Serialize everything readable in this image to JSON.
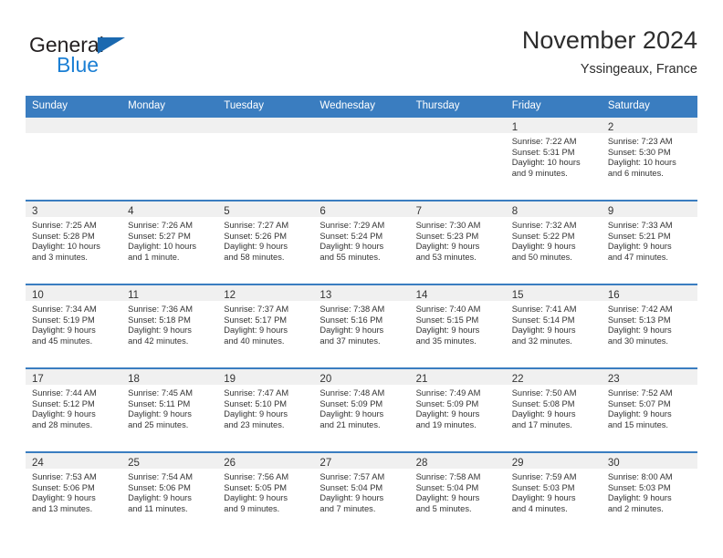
{
  "brand": {
    "name_part1": "General",
    "name_part2": "Blue",
    "triangle_color": "#1b69b0",
    "blue_color": "#1b7fd4"
  },
  "header": {
    "title": "November 2024",
    "subtitle": "Yssingeaux, France"
  },
  "theme": {
    "header_bg": "#3a7dc0",
    "daynum_bg": "#f0f0f0",
    "text": "#333333"
  },
  "weekdays": [
    "Sunday",
    "Monday",
    "Tuesday",
    "Wednesday",
    "Thursday",
    "Friday",
    "Saturday"
  ],
  "weeks": [
    [
      {
        "day": "",
        "lines": []
      },
      {
        "day": "",
        "lines": []
      },
      {
        "day": "",
        "lines": []
      },
      {
        "day": "",
        "lines": []
      },
      {
        "day": "",
        "lines": []
      },
      {
        "day": "1",
        "lines": [
          "Sunrise: 7:22 AM",
          "Sunset: 5:31 PM",
          "Daylight: 10 hours",
          "and 9 minutes."
        ]
      },
      {
        "day": "2",
        "lines": [
          "Sunrise: 7:23 AM",
          "Sunset: 5:30 PM",
          "Daylight: 10 hours",
          "and 6 minutes."
        ]
      }
    ],
    [
      {
        "day": "3",
        "lines": [
          "Sunrise: 7:25 AM",
          "Sunset: 5:28 PM",
          "Daylight: 10 hours",
          "and 3 minutes."
        ]
      },
      {
        "day": "4",
        "lines": [
          "Sunrise: 7:26 AM",
          "Sunset: 5:27 PM",
          "Daylight: 10 hours",
          "and 1 minute."
        ]
      },
      {
        "day": "5",
        "lines": [
          "Sunrise: 7:27 AM",
          "Sunset: 5:26 PM",
          "Daylight: 9 hours",
          "and 58 minutes."
        ]
      },
      {
        "day": "6",
        "lines": [
          "Sunrise: 7:29 AM",
          "Sunset: 5:24 PM",
          "Daylight: 9 hours",
          "and 55 minutes."
        ]
      },
      {
        "day": "7",
        "lines": [
          "Sunrise: 7:30 AM",
          "Sunset: 5:23 PM",
          "Daylight: 9 hours",
          "and 53 minutes."
        ]
      },
      {
        "day": "8",
        "lines": [
          "Sunrise: 7:32 AM",
          "Sunset: 5:22 PM",
          "Daylight: 9 hours",
          "and 50 minutes."
        ]
      },
      {
        "day": "9",
        "lines": [
          "Sunrise: 7:33 AM",
          "Sunset: 5:21 PM",
          "Daylight: 9 hours",
          "and 47 minutes."
        ]
      }
    ],
    [
      {
        "day": "10",
        "lines": [
          "Sunrise: 7:34 AM",
          "Sunset: 5:19 PM",
          "Daylight: 9 hours",
          "and 45 minutes."
        ]
      },
      {
        "day": "11",
        "lines": [
          "Sunrise: 7:36 AM",
          "Sunset: 5:18 PM",
          "Daylight: 9 hours",
          "and 42 minutes."
        ]
      },
      {
        "day": "12",
        "lines": [
          "Sunrise: 7:37 AM",
          "Sunset: 5:17 PM",
          "Daylight: 9 hours",
          "and 40 minutes."
        ]
      },
      {
        "day": "13",
        "lines": [
          "Sunrise: 7:38 AM",
          "Sunset: 5:16 PM",
          "Daylight: 9 hours",
          "and 37 minutes."
        ]
      },
      {
        "day": "14",
        "lines": [
          "Sunrise: 7:40 AM",
          "Sunset: 5:15 PM",
          "Daylight: 9 hours",
          "and 35 minutes."
        ]
      },
      {
        "day": "15",
        "lines": [
          "Sunrise: 7:41 AM",
          "Sunset: 5:14 PM",
          "Daylight: 9 hours",
          "and 32 minutes."
        ]
      },
      {
        "day": "16",
        "lines": [
          "Sunrise: 7:42 AM",
          "Sunset: 5:13 PM",
          "Daylight: 9 hours",
          "and 30 minutes."
        ]
      }
    ],
    [
      {
        "day": "17",
        "lines": [
          "Sunrise: 7:44 AM",
          "Sunset: 5:12 PM",
          "Daylight: 9 hours",
          "and 28 minutes."
        ]
      },
      {
        "day": "18",
        "lines": [
          "Sunrise: 7:45 AM",
          "Sunset: 5:11 PM",
          "Daylight: 9 hours",
          "and 25 minutes."
        ]
      },
      {
        "day": "19",
        "lines": [
          "Sunrise: 7:47 AM",
          "Sunset: 5:10 PM",
          "Daylight: 9 hours",
          "and 23 minutes."
        ]
      },
      {
        "day": "20",
        "lines": [
          "Sunrise: 7:48 AM",
          "Sunset: 5:09 PM",
          "Daylight: 9 hours",
          "and 21 minutes."
        ]
      },
      {
        "day": "21",
        "lines": [
          "Sunrise: 7:49 AM",
          "Sunset: 5:09 PM",
          "Daylight: 9 hours",
          "and 19 minutes."
        ]
      },
      {
        "day": "22",
        "lines": [
          "Sunrise: 7:50 AM",
          "Sunset: 5:08 PM",
          "Daylight: 9 hours",
          "and 17 minutes."
        ]
      },
      {
        "day": "23",
        "lines": [
          "Sunrise: 7:52 AM",
          "Sunset: 5:07 PM",
          "Daylight: 9 hours",
          "and 15 minutes."
        ]
      }
    ],
    [
      {
        "day": "24",
        "lines": [
          "Sunrise: 7:53 AM",
          "Sunset: 5:06 PM",
          "Daylight: 9 hours",
          "and 13 minutes."
        ]
      },
      {
        "day": "25",
        "lines": [
          "Sunrise: 7:54 AM",
          "Sunset: 5:06 PM",
          "Daylight: 9 hours",
          "and 11 minutes."
        ]
      },
      {
        "day": "26",
        "lines": [
          "Sunrise: 7:56 AM",
          "Sunset: 5:05 PM",
          "Daylight: 9 hours",
          "and 9 minutes."
        ]
      },
      {
        "day": "27",
        "lines": [
          "Sunrise: 7:57 AM",
          "Sunset: 5:04 PM",
          "Daylight: 9 hours",
          "and 7 minutes."
        ]
      },
      {
        "day": "28",
        "lines": [
          "Sunrise: 7:58 AM",
          "Sunset: 5:04 PM",
          "Daylight: 9 hours",
          "and 5 minutes."
        ]
      },
      {
        "day": "29",
        "lines": [
          "Sunrise: 7:59 AM",
          "Sunset: 5:03 PM",
          "Daylight: 9 hours",
          "and 4 minutes."
        ]
      },
      {
        "day": "30",
        "lines": [
          "Sunrise: 8:00 AM",
          "Sunset: 5:03 PM",
          "Daylight: 9 hours",
          "and 2 minutes."
        ]
      }
    ]
  ]
}
